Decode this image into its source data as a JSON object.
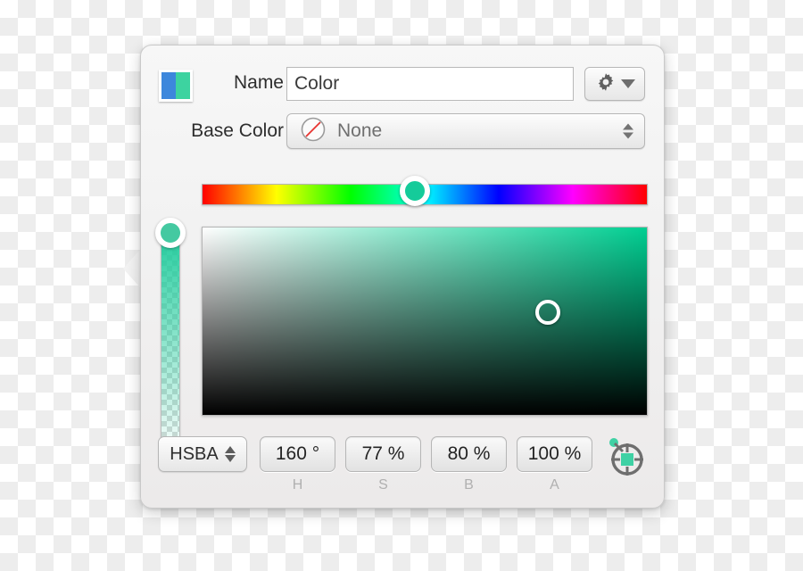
{
  "window": {
    "type": "color-picker-popover",
    "background": "transparency-checkerboard"
  },
  "header": {
    "swatch": {
      "name": "color-swatch",
      "left_color": "#3d87dc",
      "right_color": "#3dd3a0"
    },
    "name_label": "Name",
    "name_value": "Color",
    "name_placeholder": "Color",
    "gear_icon": "gear-icon",
    "gear_disclosure_icon": "chevron-down-icon",
    "base_color_label": "Base Color",
    "base_color_value": "None",
    "base_color_icon": "no-color-slash-icon",
    "base_color_stepper_icon": "up-down-arrows-icon"
  },
  "hue_slider": {
    "name": "hue-slider",
    "value_deg": 160,
    "knob_color": "#15cb9a",
    "gradient_stops": [
      "#ff0000",
      "#ffff00",
      "#00ff00",
      "#00ffff",
      "#0000ff",
      "#ff00ff",
      "#ff0000"
    ]
  },
  "alpha_slider": {
    "name": "alpha-slider",
    "orientation": "vertical",
    "value_percent": 100,
    "top_color": "#1dcb9b",
    "knob_color": "#44c9a1"
  },
  "sb_field": {
    "name": "saturation-brightness-field",
    "hue_color": "#00cf92",
    "saturation_percent": 77,
    "brightness_percent": 80
  },
  "bottom_bar": {
    "mode_label": "HSBA",
    "mode_stepper_icon": "up-down-arrows-icon",
    "fields": [
      {
        "value": "160 °",
        "caption": "H"
      },
      {
        "value": "77 %",
        "caption": "S"
      },
      {
        "value": "80 %",
        "caption": "B"
      },
      {
        "value": "100 %",
        "caption": "A"
      }
    ],
    "picker_tool_icon": "target-eyedropper-icon",
    "picker_tool_accent": "#3fd1a4",
    "picker_tool_stroke": "#6e6e6e"
  }
}
